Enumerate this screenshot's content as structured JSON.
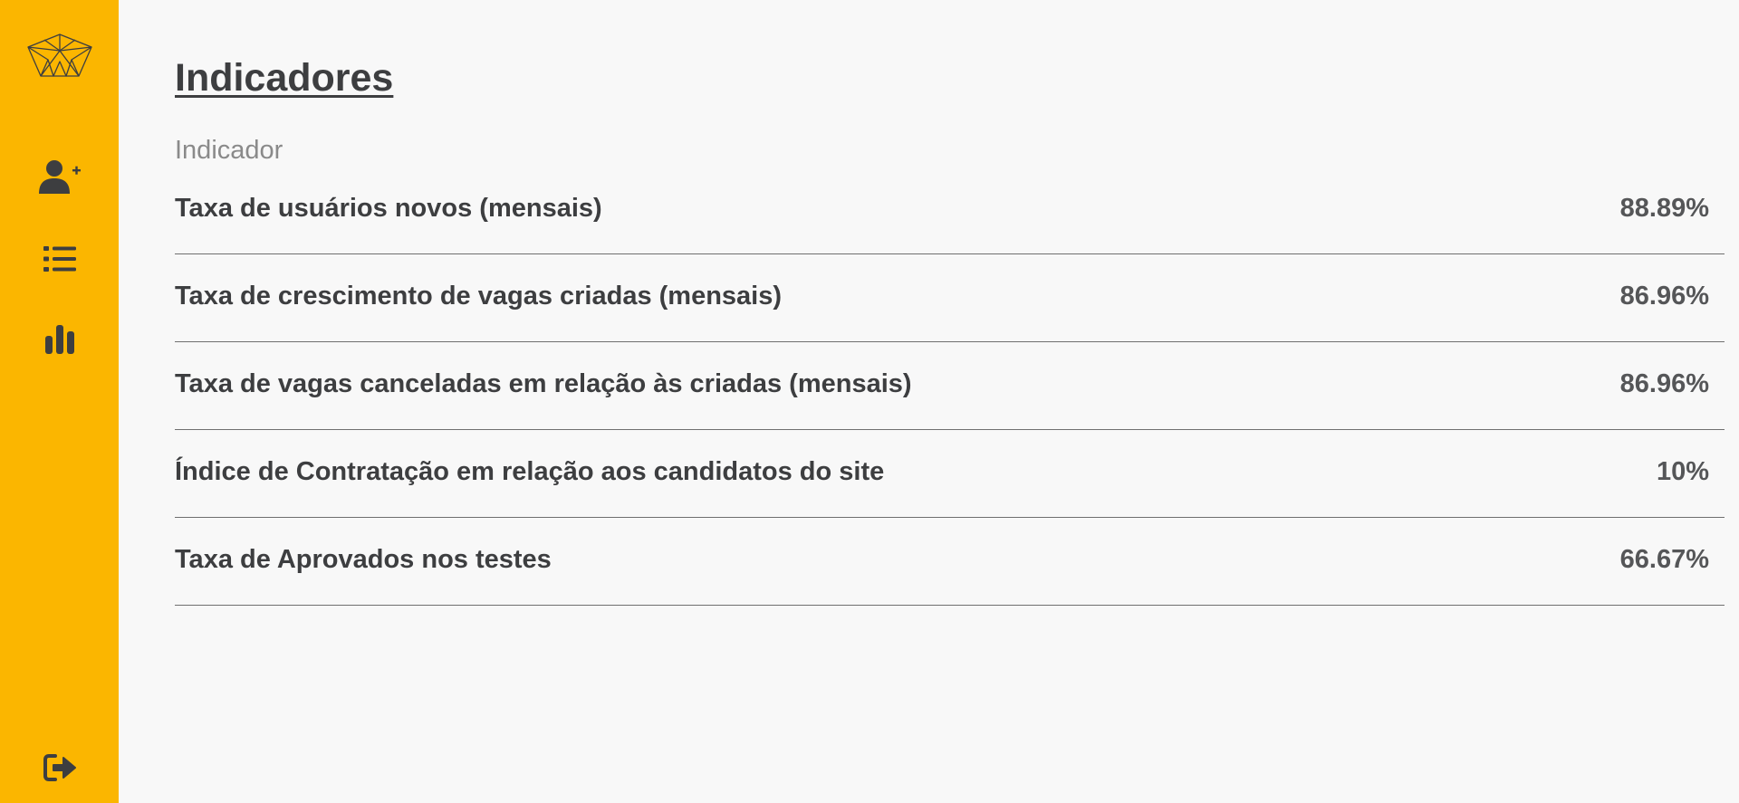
{
  "sidebar": {
    "logo_icon": "origami-crown-logo",
    "items": [
      {
        "icon": "user-plus-icon"
      },
      {
        "icon": "list-icon"
      },
      {
        "icon": "bar-chart-icon"
      }
    ],
    "logout_icon": "sign-out-icon",
    "background_color": "#fbb600"
  },
  "main": {
    "title": "Indicadores",
    "column_header": "Indicador",
    "indicators": [
      {
        "label": "Taxa de usuários novos (mensais)",
        "value": "88.89%"
      },
      {
        "label": "Taxa de crescimento de vagas criadas (mensais)",
        "value": "86.96%"
      },
      {
        "label": "Taxa de vagas canceladas em relação às criadas (mensais)",
        "value": "86.96%"
      },
      {
        "label": "Índice de Contratação em relação aos candidatos do site",
        "value": "10%"
      },
      {
        "label": "Taxa de Aprovados nos testes",
        "value": "66.67%"
      }
    ]
  },
  "colors": {
    "accent": "#fbb600",
    "text": "#3d3e40",
    "muted": "#8a8a8a",
    "background": "#f8f8f8"
  }
}
